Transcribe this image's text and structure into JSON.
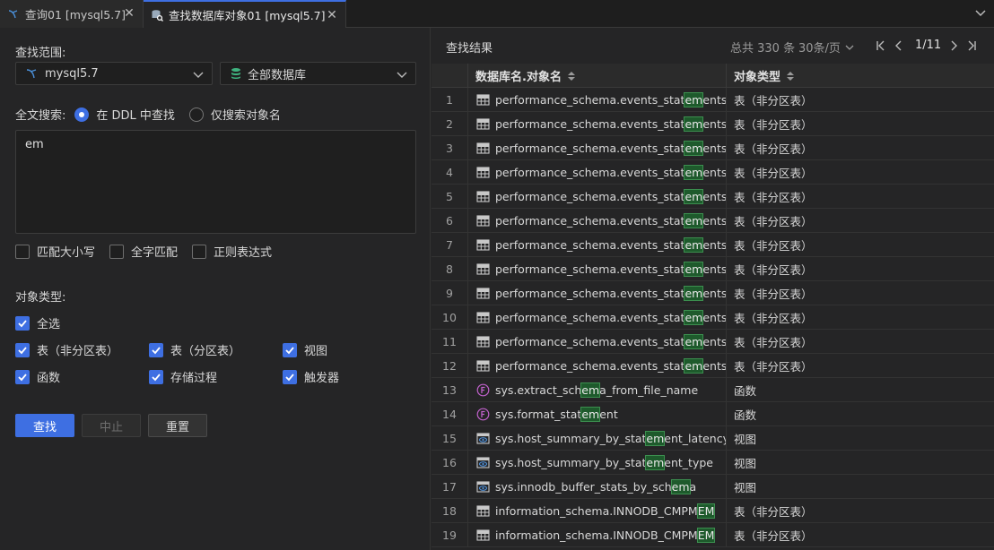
{
  "tabs": [
    {
      "label": "查询01 [mysql5.7]"
    },
    {
      "label": "查找数据库对象01 [mysql5.7]"
    }
  ],
  "search": {
    "scope_label": "查找范围:",
    "connection": "mysql5.7",
    "database": "全部数据库",
    "fulltext_label": "全文搜索:",
    "mode_ddl": "在 DDL 中查找",
    "mode_name": "仅搜索对象名",
    "query": "em",
    "opt_case": "匹配大小写",
    "opt_word": "全字匹配",
    "opt_regex": "正则表达式",
    "types_label": "对象类型:",
    "type_all": "全选",
    "type_table": "表（非分区表）",
    "type_ptable": "表（分区表）",
    "type_view": "视图",
    "type_func": "函数",
    "type_proc": "存储过程",
    "type_trigger": "触发器",
    "btn_find": "查找",
    "btn_stop": "中止",
    "btn_reset": "重置"
  },
  "results": {
    "title": "查找结果",
    "total": "总共 330 条",
    "per_page": "30条/页",
    "page": "1/11",
    "col_name": "数据库名.对象名",
    "col_type": "对象类型",
    "rows": [
      {
        "n": "1",
        "icon": "table-icon",
        "pre": "performance_schema.events_stat",
        "hit": "em",
        "post": "ents...",
        "type": "表（非分区表）"
      },
      {
        "n": "2",
        "icon": "table-icon",
        "pre": "performance_schema.events_stat",
        "hit": "em",
        "post": "ents...",
        "type": "表（非分区表）"
      },
      {
        "n": "3",
        "icon": "table-icon",
        "pre": "performance_schema.events_stat",
        "hit": "em",
        "post": "ents...",
        "type": "表（非分区表）"
      },
      {
        "n": "4",
        "icon": "table-icon",
        "pre": "performance_schema.events_stat",
        "hit": "em",
        "post": "ents...",
        "type": "表（非分区表）"
      },
      {
        "n": "5",
        "icon": "table-icon",
        "pre": "performance_schema.events_stat",
        "hit": "em",
        "post": "ents...",
        "type": "表（非分区表）"
      },
      {
        "n": "6",
        "icon": "table-icon",
        "pre": "performance_schema.events_stat",
        "hit": "em",
        "post": "ents...",
        "type": "表（非分区表）"
      },
      {
        "n": "7",
        "icon": "table-icon",
        "pre": "performance_schema.events_stat",
        "hit": "em",
        "post": "ents...",
        "type": "表（非分区表）"
      },
      {
        "n": "8",
        "icon": "table-icon",
        "pre": "performance_schema.events_stat",
        "hit": "em",
        "post": "ents...",
        "type": "表（非分区表）"
      },
      {
        "n": "9",
        "icon": "table-icon",
        "pre": "performance_schema.events_stat",
        "hit": "em",
        "post": "ents...",
        "type": "表（非分区表）"
      },
      {
        "n": "10",
        "icon": "table-icon",
        "pre": "performance_schema.events_stat",
        "hit": "em",
        "post": "ents...",
        "type": "表（非分区表）"
      },
      {
        "n": "11",
        "icon": "table-icon",
        "pre": "performance_schema.events_stat",
        "hit": "em",
        "post": "ents...",
        "type": "表（非分区表）"
      },
      {
        "n": "12",
        "icon": "table-icon",
        "pre": "performance_schema.events_stat",
        "hit": "em",
        "post": "ents...",
        "type": "表（非分区表）"
      },
      {
        "n": "13",
        "icon": "function-icon",
        "pre": "sys.extract_sch",
        "hit": "em",
        "post": "a_from_file_name",
        "type": "函数"
      },
      {
        "n": "14",
        "icon": "function-icon",
        "pre": "sys.format_stat",
        "hit": "em",
        "post": "ent",
        "type": "函数"
      },
      {
        "n": "15",
        "icon": "view-icon",
        "pre": "sys.host_summary_by_stat",
        "hit": "em",
        "post": "ent_latency",
        "type": "视图"
      },
      {
        "n": "16",
        "icon": "view-icon",
        "pre": "sys.host_summary_by_stat",
        "hit": "em",
        "post": "ent_type",
        "type": "视图"
      },
      {
        "n": "17",
        "icon": "view-icon",
        "pre": "sys.innodb_buffer_stats_by_sch",
        "hit": "em",
        "post": "a",
        "type": "视图"
      },
      {
        "n": "18",
        "icon": "table-icon",
        "pre": "information_schema.INNODB_CMPM",
        "hit": "EM",
        "post": "",
        "type": "表（非分区表）"
      },
      {
        "n": "19",
        "icon": "table-icon",
        "pre": "information_schema.INNODB_CMPM",
        "hit": "EM",
        "post": "",
        "type": "表（非分区表）"
      }
    ]
  },
  "colors": {
    "accent": "#3e6fe2",
    "highlight": "#1e5a2c",
    "func": "#c061cb",
    "view": "#4f8fd6"
  }
}
